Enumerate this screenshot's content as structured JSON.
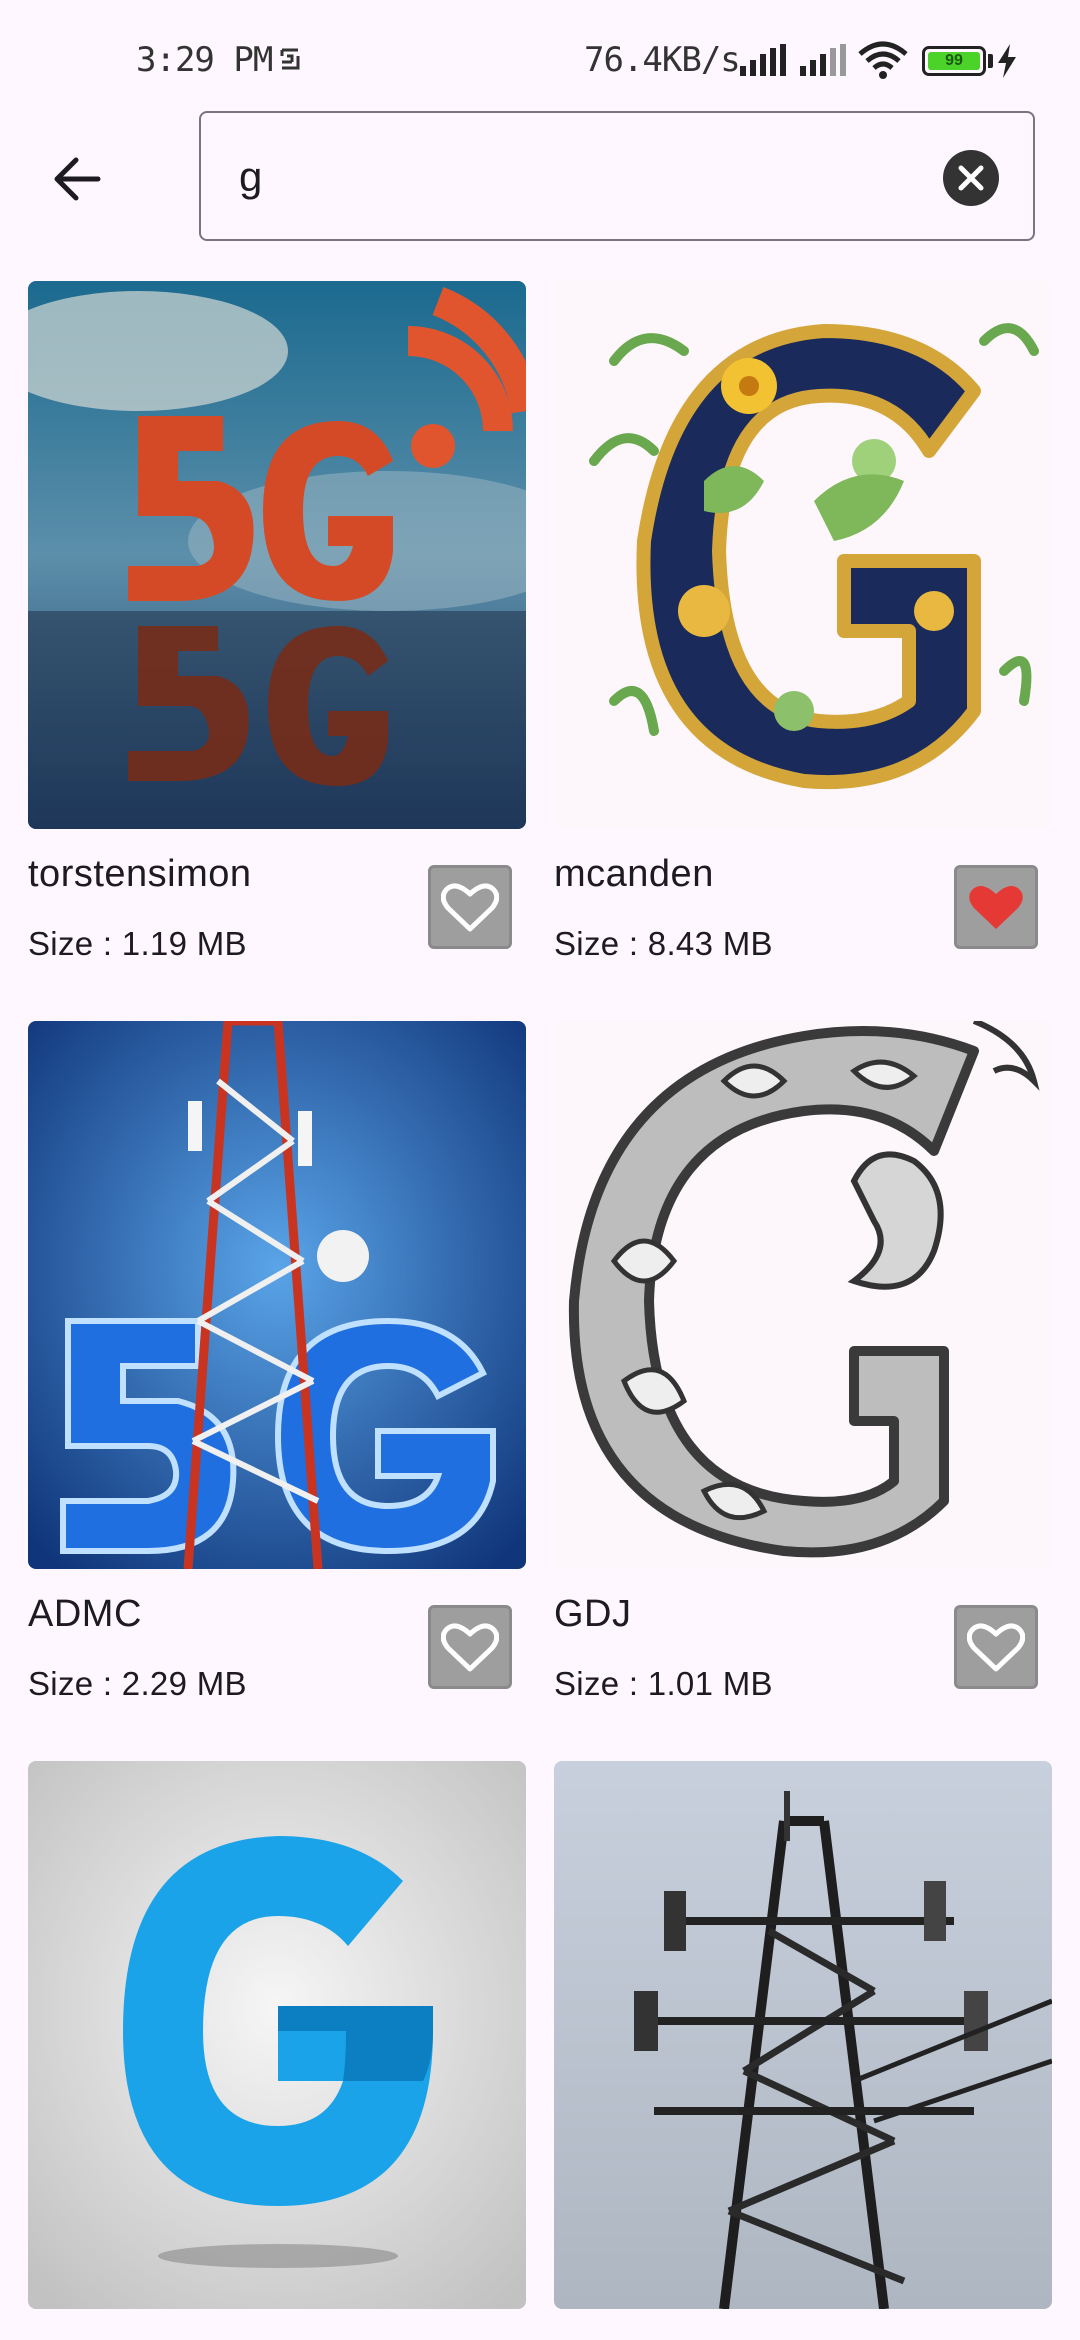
{
  "status_bar": {
    "time": "3:29 PM",
    "network_speed": "76.4KB/s",
    "battery_level": "99",
    "icons": [
      "clock-sync-icon",
      "signal-icon",
      "signal-icon",
      "wifi-icon",
      "battery-icon",
      "charging-bolt-icon"
    ]
  },
  "app_bar": {
    "back_icon": "arrow-left-icon",
    "search_value": "g",
    "clear_icon": "close-circle-icon"
  },
  "results": [
    {
      "author": "torstensimon",
      "size": "Size : 1.19 MB",
      "favorite": false,
      "image": "5G red letters on reflective surface"
    },
    {
      "author": "mcanden",
      "size": "Size : 8.43 MB",
      "favorite": true,
      "image": "Ornate floral letter G"
    },
    {
      "author": "ADMC",
      "size": "Size : 2.29 MB",
      "favorite": false,
      "image": "Blue 5G with transmission tower"
    },
    {
      "author": "GDJ",
      "size": "Size : 1.01 MB",
      "favorite": false,
      "image": "Ornate engraved letter G"
    },
    {
      "author": "",
      "size": "",
      "favorite": false,
      "image": "Blue G logo on grey background"
    },
    {
      "author": "",
      "size": "",
      "favorite": false,
      "image": "Telecommunication tower"
    }
  ],
  "colors": {
    "background": "#fef7ff",
    "favorite_active": "#e53935",
    "favorite_inactive": "#ffffff",
    "fav_button_bg": "#9e9e9e"
  }
}
